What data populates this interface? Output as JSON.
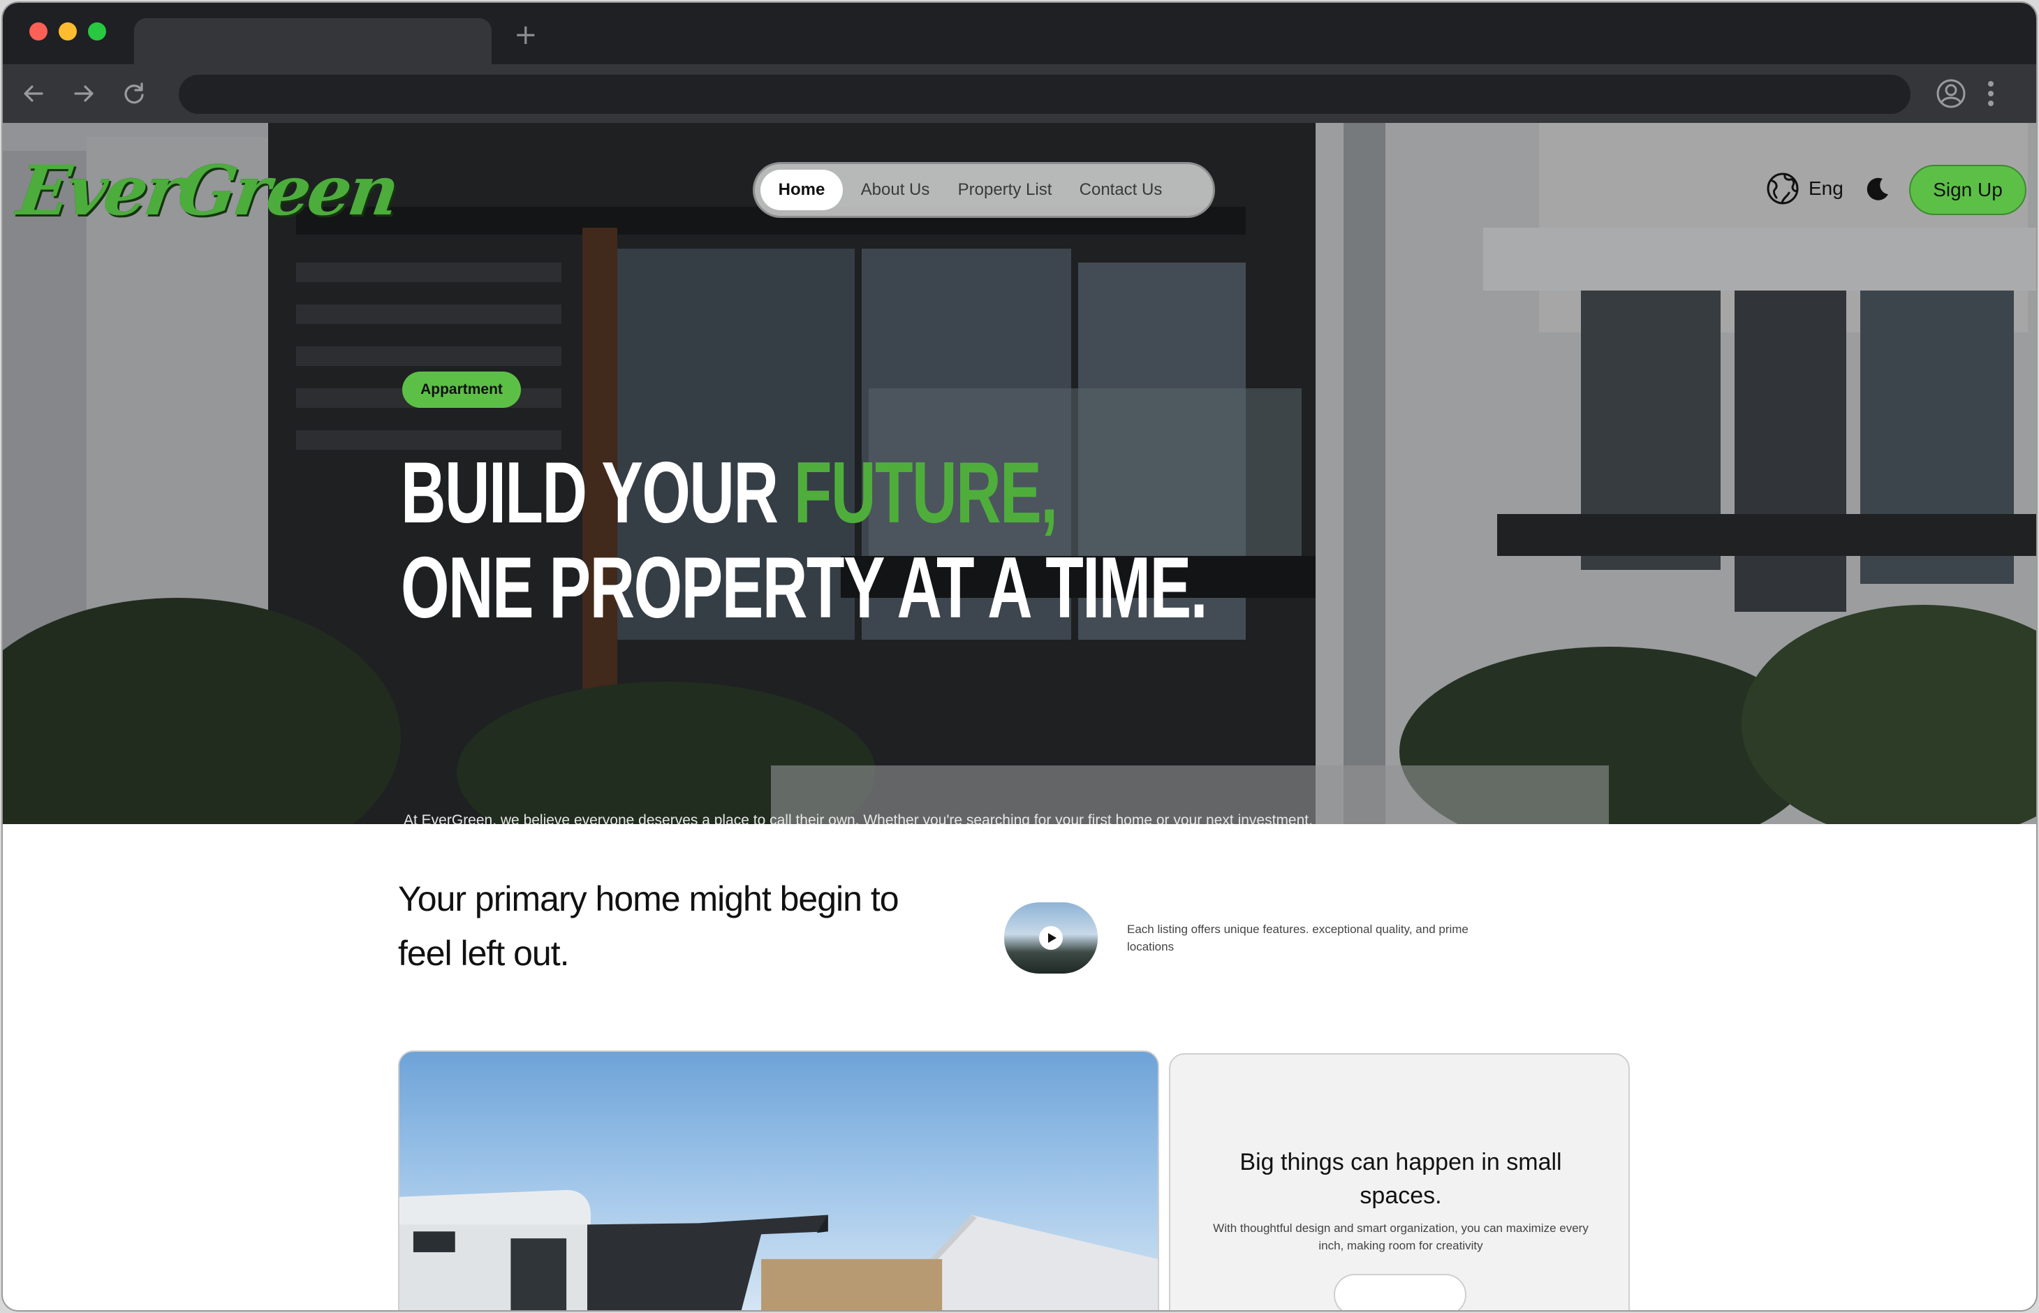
{
  "browser": {
    "new_tab_glyph": "+",
    "icons": [
      "back-icon",
      "forward-icon",
      "reload-icon",
      "profile-icon",
      "menu-icon"
    ]
  },
  "header": {
    "logo": "EverGreen",
    "nav": [
      "Home",
      "About Us",
      "Property List",
      "Contact Us"
    ],
    "active_nav": "Home",
    "language": "Eng",
    "signup": "Sign Up"
  },
  "hero": {
    "badge": "Appartment",
    "headline_part1": "BUILD YOUR ",
    "headline_accent": "FUTURE,",
    "headline_line2": "ONE PROPERTY AT A TIME.",
    "description": "At EverGreen, we believe everyone deserves a place to call their own. Whether you're searching for your first home or your next investment, we're here to help you own your world—one property at a time. Discover spaces that match your lifestyle, goals, and dreams."
  },
  "intro": {
    "title": "Your primary home might begin to feel left out.",
    "text": "Each listing offers unique features. exceptional quality, and prime locations"
  },
  "card": {
    "title": "Big things can happen in small spaces.",
    "text": "With thoughtful design and smart organization, you can maximize every inch, making room for creativity"
  },
  "colors": {
    "accent": "#5cc046",
    "headline_accent": "#4fae3b",
    "chrome_dark": "#1f2023",
    "chrome_toolbar": "#35363a"
  }
}
